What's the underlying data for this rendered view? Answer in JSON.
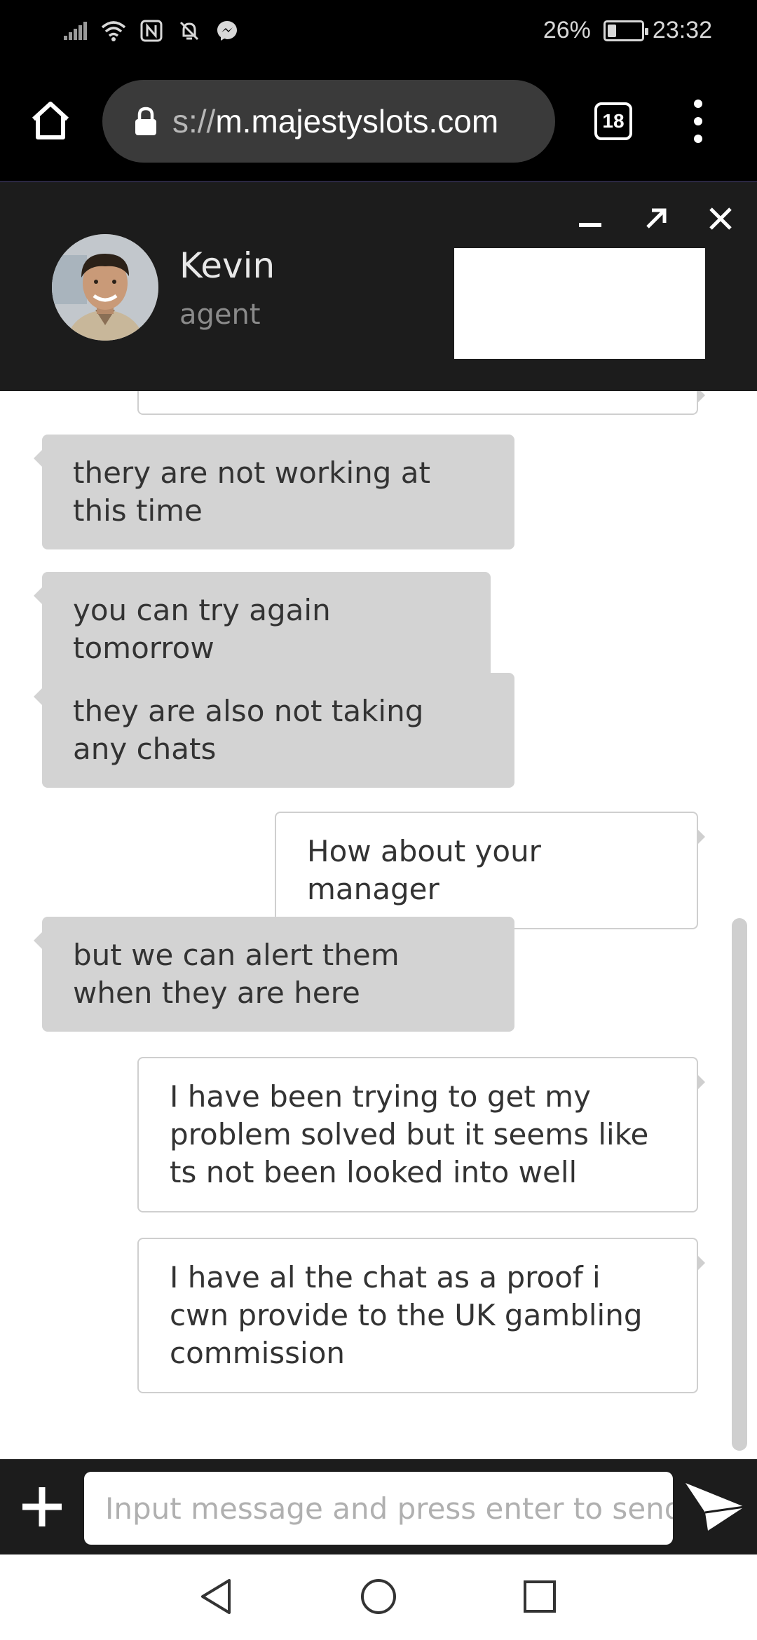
{
  "status_bar": {
    "icons": [
      "signal-icon",
      "wifi-icon",
      "nfc-icon",
      "mute-icon",
      "messenger-icon"
    ],
    "battery_percent_label": "26%",
    "battery_level": 0.26,
    "time": "23:32"
  },
  "browser": {
    "url_scheme": "s://",
    "url_host": "m.majestyslots.com",
    "tab_count": "18"
  },
  "chat_header": {
    "agent_name": "Kevin",
    "agent_role": "agent",
    "controls": [
      "minimize-icon",
      "expand-icon",
      "close-icon"
    ]
  },
  "messages": [
    {
      "sender": "agent",
      "text": "thery are not working at this time"
    },
    {
      "sender": "agent",
      "text": "you can try again tomorrow"
    },
    {
      "sender": "agent",
      "text": "they are also not taking any chats"
    },
    {
      "sender": "user",
      "text": "How about your manager"
    },
    {
      "sender": "agent",
      "text": "but we can alert them when they are here"
    },
    {
      "sender": "user",
      "text": "I have been trying to get my problem solved but it seems like ts not been looked into well"
    },
    {
      "sender": "user",
      "text": "I have al the chat as a proof i cwn provide to the UK gambling commission"
    }
  ],
  "input": {
    "placeholder": "Input message and press enter to send",
    "value": ""
  },
  "colors": {
    "header_bg": "#1c1c1c",
    "agent_bubble": "#d3d3d3",
    "user_bubble_border": "#cfcfcf"
  }
}
